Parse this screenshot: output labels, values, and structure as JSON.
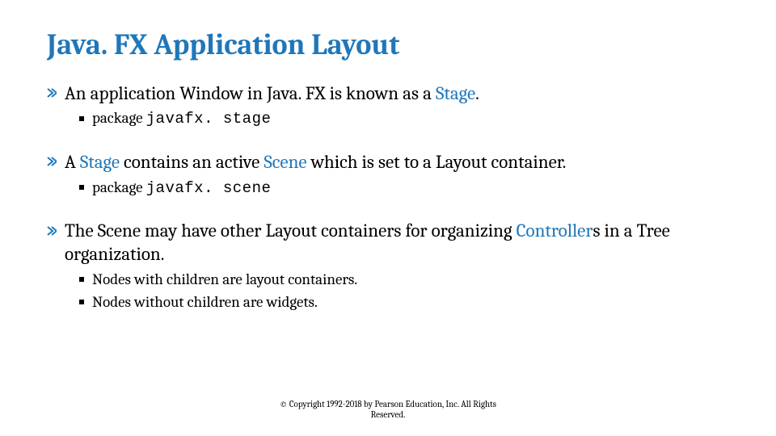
{
  "title": "Java. FX Application Layout",
  "bullets": [
    {
      "parts": [
        {
          "t": "An application Window in Java. FX is known as a ",
          "hl": false
        },
        {
          "t": "Stage",
          "hl": true
        },
        {
          "t": ".",
          "hl": false
        }
      ],
      "sub": [
        {
          "pre": "package ",
          "code": "javafx. stage"
        }
      ]
    },
    {
      "parts": [
        {
          "t": "A ",
          "hl": false
        },
        {
          "t": "Stage",
          "hl": true
        },
        {
          "t": " contains an active ",
          "hl": false
        },
        {
          "t": "Scene",
          "hl": true
        },
        {
          "t": " which is set to a Layout container.",
          "hl": false
        }
      ],
      "sub": [
        {
          "pre": "package ",
          "code": "javafx. scene"
        }
      ]
    },
    {
      "parts": [
        {
          "t": "The Scene may have other Layout containers for organizing ",
          "hl": false
        },
        {
          "t": "Controller",
          "hl": true
        },
        {
          "t": "s in a Tree organization.",
          "hl": false
        }
      ],
      "sub": [
        {
          "plain": "Nodes with children are layout containers."
        },
        {
          "plain": "Nodes without children are widgets."
        }
      ]
    }
  ],
  "footer1": "© Copyright 1992-2018 by Pearson Education, Inc. All Rights",
  "footer2": "Reserved."
}
